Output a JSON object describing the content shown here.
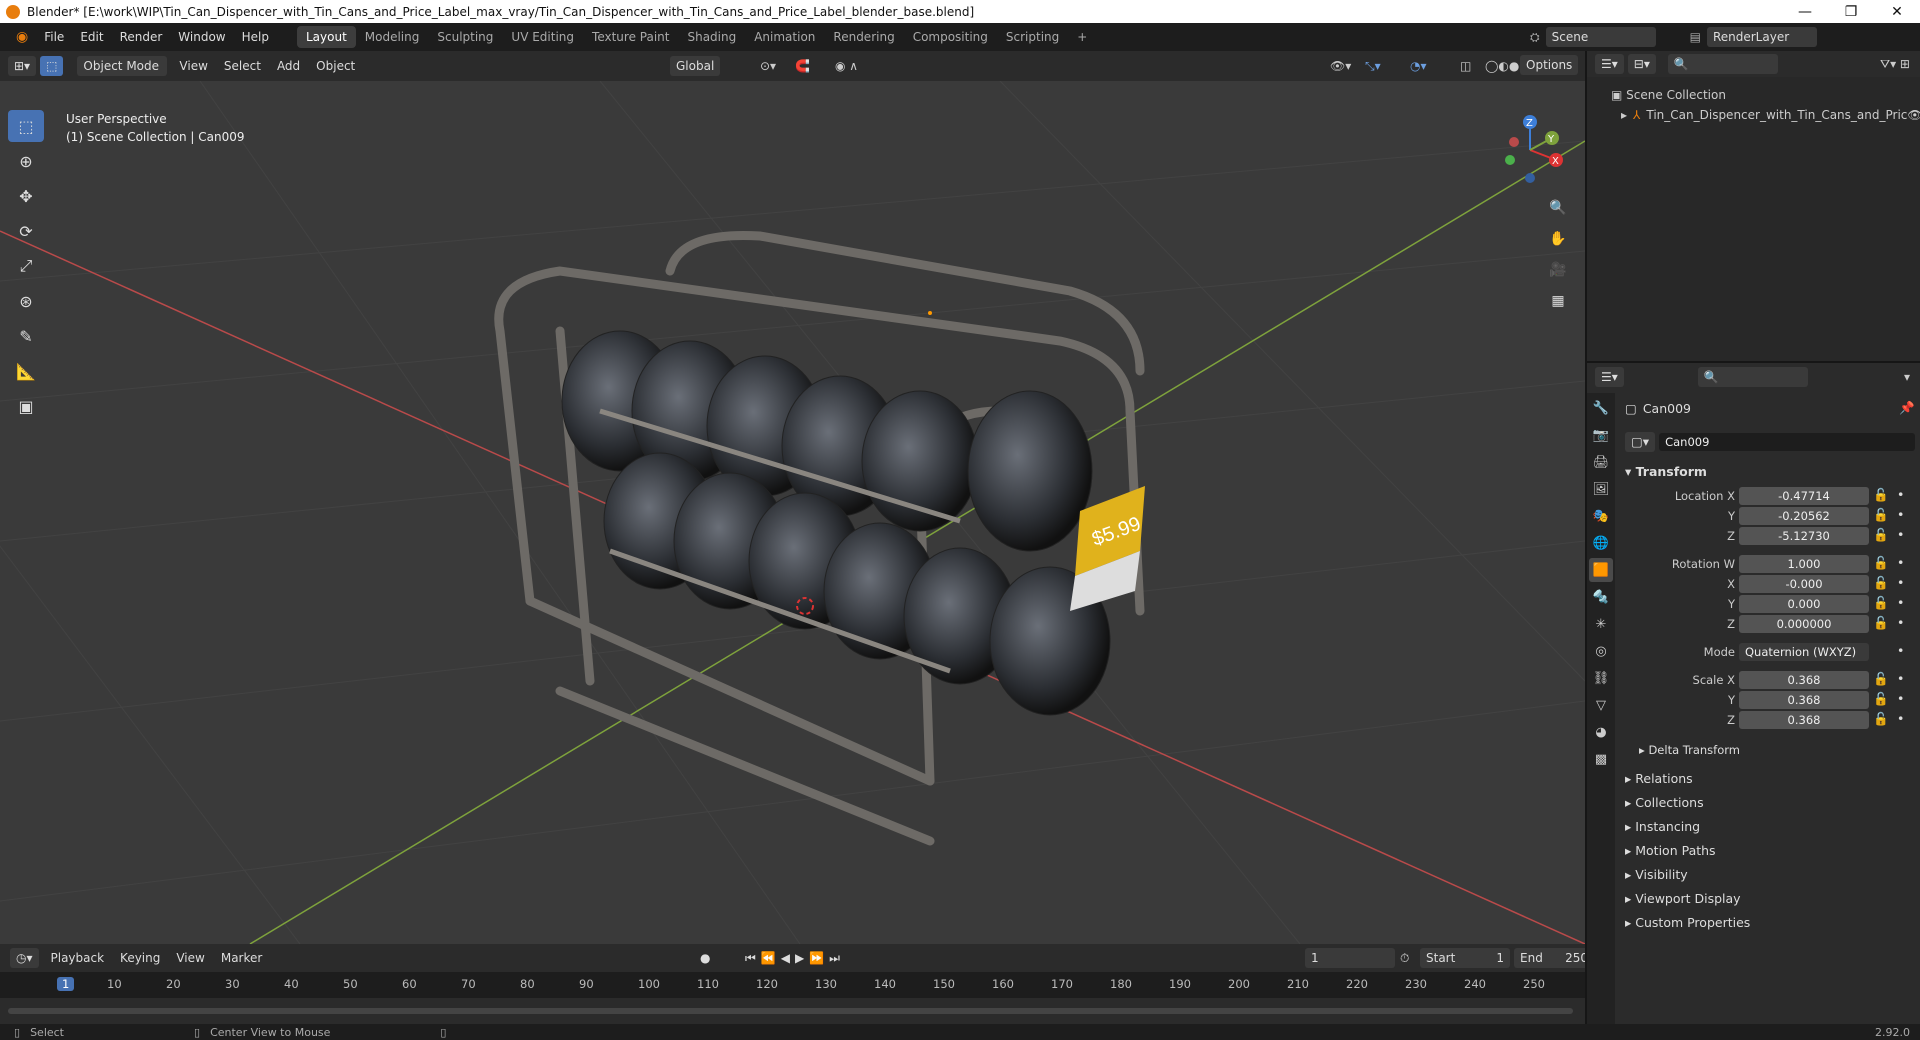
{
  "window": {
    "title": "Blender* [E:\\work\\WIP\\Tin_Can_Dispencer_with_Tin_Cans_and_Price_Label_max_vray/Tin_Can_Dispencer_with_Tin_Cans_and_Price_Label_blender_base.blend]"
  },
  "menus": [
    "File",
    "Edit",
    "Render",
    "Window",
    "Help"
  ],
  "workspaces": [
    "Layout",
    "Modeling",
    "Sculpting",
    "UV Editing",
    "Texture Paint",
    "Shading",
    "Animation",
    "Rendering",
    "Compositing",
    "Scripting"
  ],
  "scene": {
    "name": "Scene",
    "view_layer": "RenderLayer"
  },
  "viewport": {
    "mode": "Object Mode",
    "menu": [
      "View",
      "Select",
      "Add",
      "Object"
    ],
    "orientation": "Global",
    "options_label": "Options",
    "overlay_line1": "User Perspective",
    "overlay_line2": "(1) Scene Collection | Can009",
    "price_label": "$5.99"
  },
  "outliner": {
    "root": "Scene Collection",
    "item": "Tin_Can_Dispencer_with_Tin_Cans_and_Pric"
  },
  "properties": {
    "object_name": "Can009",
    "data_name": "Can009",
    "transform_title": "Transform",
    "location": {
      "label_x": "Location X",
      "x": "-0.47714",
      "y": "-0.20562",
      "z": "-5.12730"
    },
    "rotation": {
      "label_w": "Rotation W",
      "w": "1.000",
      "x": "-0.000",
      "y": "0.000",
      "z": "0.000000"
    },
    "mode_label": "Mode",
    "mode_value": "Quaternion (WXYZ)",
    "scale": {
      "label_x": "Scale X",
      "x": "0.368",
      "y": "0.368",
      "z": "0.368"
    },
    "axis_y": "Y",
    "axis_z": "Z",
    "axis_x": "X",
    "delta": "Delta Transform",
    "panels": [
      "Relations",
      "Collections",
      "Instancing",
      "Motion Paths",
      "Visibility",
      "Viewport Display",
      "Custom Properties"
    ]
  },
  "timeline": {
    "menu": [
      "Playback",
      "Keying",
      "View",
      "Marker"
    ],
    "current_frame": "1",
    "start_label": "Start",
    "start": "1",
    "end_label": "End",
    "end": "250",
    "ticks": [
      "1",
      "10",
      "20",
      "30",
      "40",
      "50",
      "60",
      "70",
      "80",
      "90",
      "100",
      "110",
      "120",
      "130",
      "140",
      "150",
      "160",
      "170",
      "180",
      "190",
      "200",
      "210",
      "220",
      "230",
      "240",
      "250"
    ]
  },
  "status": {
    "select": "Select",
    "center": "Center View to Mouse",
    "version": "2.92.0"
  },
  "colors": {
    "accent": "#4772b3",
    "bg": "#3a3a3a",
    "xaxis": "#b94a4a",
    "yaxis": "#7ea23c"
  }
}
